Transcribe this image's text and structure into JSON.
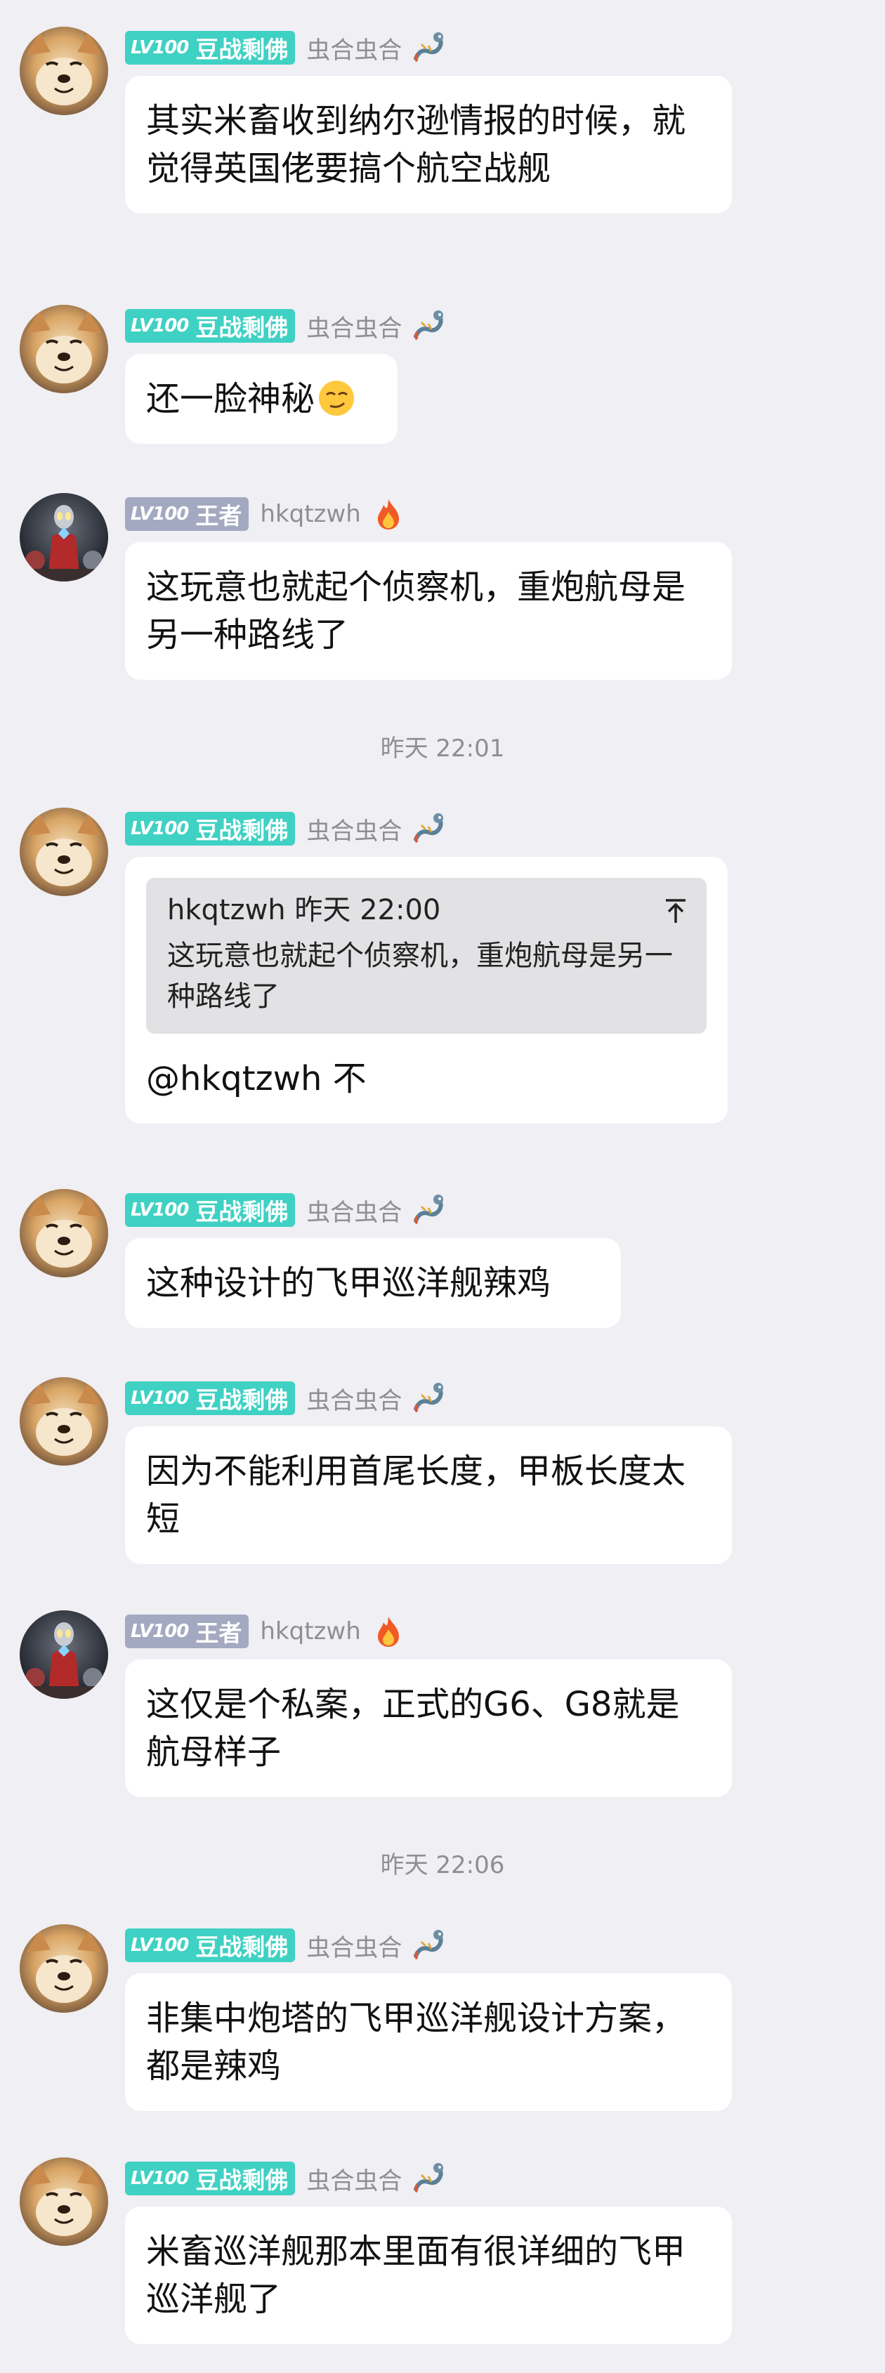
{
  "timestamps": [
    "昨天 22:01",
    "昨天 22:06"
  ],
  "users": {
    "dou": {
      "level": "LV100",
      "title": "豆战剩佛",
      "nickname": "虫合虫合"
    },
    "hk": {
      "level": "LV100",
      "title": "王者",
      "nickname": "hkqtzwh"
    }
  },
  "messages": [
    {
      "user": "dou",
      "text": "其实米畜收到纳尔逊情报的时候，就觉得英国佬要搞个航空战舰"
    },
    {
      "user": "dou",
      "text": "还一脸神秘"
    },
    {
      "user": "hk",
      "text": "这玩意也就起个侦察机，重炮航母是另一种路线了"
    },
    {
      "user": "dou",
      "quote": {
        "author": "hkqtzwh",
        "time": "昨天 22:00",
        "text": "这玩意也就起个侦察机，重炮航母是另一种路线了"
      },
      "text": "@hkqtzwh 不"
    },
    {
      "user": "dou",
      "text": "这种设计的飞甲巡洋舰辣鸡"
    },
    {
      "user": "dou",
      "text": "因为不能利用首尾长度，甲板长度太短"
    },
    {
      "user": "hk",
      "text": "这仅是个私案，正式的G6、G8就是航母样子"
    },
    {
      "user": "dou",
      "text": "非集中炮塔的飞甲巡洋舰设计方案，都是辣鸡"
    },
    {
      "user": "dou",
      "text": "米畜巡洋舰那本里面有很详细的飞甲巡洋舰了"
    }
  ],
  "colors": {
    "background": "#efeff4",
    "badge_teal": "#3fd1c3",
    "badge_gray": "#a3a9c0",
    "bubble": "#ffffff",
    "nickname": "#8e8e93"
  },
  "icons": {
    "dou_avatar": "shiba-dog-avatar",
    "hk_avatar": "ultraman-avatar",
    "dou_deco": "dragon-icon",
    "hk_deco": "flame-icon",
    "emoji": "smirk-emoji",
    "quote": "scroll-to-quote-icon"
  }
}
